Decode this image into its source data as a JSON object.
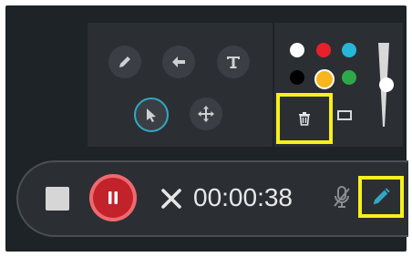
{
  "toolbar": {
    "timer": "00:00:38"
  },
  "drawing_panel": {
    "tools": [
      {
        "name": "pen",
        "icon": "pencil-icon"
      },
      {
        "name": "arrow",
        "icon": "arrow-left-icon"
      },
      {
        "name": "text",
        "icon": "text-icon"
      },
      {
        "name": "select",
        "icon": "cursor-icon",
        "active": true
      },
      {
        "name": "move",
        "icon": "move-icon"
      }
    ],
    "colors": [
      "#ffffff",
      "#e8202a",
      "#28b6d6",
      "#000000",
      "#f7b51e",
      "#2fa84a"
    ],
    "selected_color": "#f7b51e",
    "stroke_size_fraction": 0.55
  },
  "accent": {
    "highlight": "#f7ef1e",
    "active_ring": "#31a8c4",
    "record": "#c2222a"
  }
}
